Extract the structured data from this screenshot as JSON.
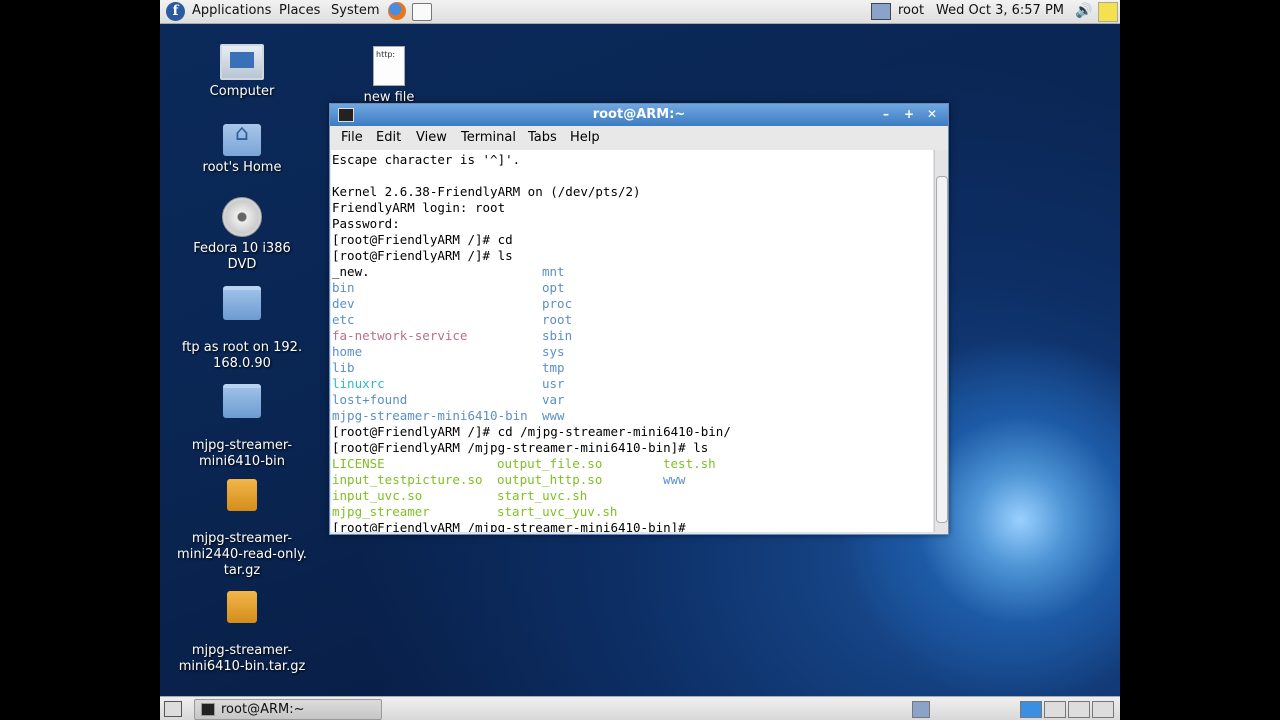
{
  "top_panel": {
    "menus": [
      "Applications",
      "Places",
      "System"
    ],
    "user": "root",
    "clock": "Wed Oct  3,  6:57 PM"
  },
  "desktop_icons": [
    {
      "label": "Computer",
      "icon": "computer-icon"
    },
    {
      "label": "root's Home",
      "icon": "home-folder-icon"
    },
    {
      "label": "Fedora 10 i386 DVD",
      "icon": "dvd-icon"
    },
    {
      "label": "ftp as root on 192.\n168.0.90",
      "icon": "network-folder-icon"
    },
    {
      "label": "mjpg-streamer-\nmini6410-bin",
      "icon": "folder-icon"
    },
    {
      "label": "mjpg-streamer-\nmini2440-read-only.\ntar.gz",
      "icon": "archive-icon"
    },
    {
      "label": "mjpg-streamer-\nmini6410-bin.tar.gz",
      "icon": "archive-icon"
    },
    {
      "label": "new file",
      "icon": "file-icon"
    }
  ],
  "new_file_icon_text": "http:",
  "terminal": {
    "title": "root@ARM:~",
    "menu": [
      "File",
      "Edit",
      "View",
      "Terminal",
      "Tabs",
      "Help"
    ],
    "lines": [
      "Escape character is '^]'.",
      "",
      "Kernel 2.6.38-FriendlyARM on (/dev/pts/2)",
      "FriendlyARM login: root",
      "Password:",
      "[root@FriendlyARM /]# cd",
      "[root@FriendlyARM /]# ls"
    ],
    "ls_root_left": [
      "_new.",
      "bin",
      "dev",
      "etc",
      "fa-network-service",
      "home",
      "lib",
      "linuxrc",
      "lost+found",
      "mjpg-streamer-mini6410-bin"
    ],
    "ls_root_right": [
      "mnt",
      "opt",
      "proc",
      "root",
      "sbin",
      "sys",
      "tmp",
      "usr",
      "var",
      "www"
    ],
    "line_cd": "[root@FriendlyARM /]# cd /mjpg-streamer-mini6410-bin/",
    "line_ls": "[root@FriendlyARM /mjpg-streamer-mini6410-bin]# ls",
    "ls_dir_col1": [
      "LICENSE",
      "input_testpicture.so",
      "input_uvc.so",
      "mjpg_streamer"
    ],
    "ls_dir_col2": [
      "output_file.so",
      "output_http.so",
      "start_uvc.sh",
      "start_uvc_yuv.sh"
    ],
    "ls_dir_col3": [
      "test.sh",
      "www"
    ],
    "prompt": "[root@FriendlyARM /mjpg-streamer-mini6410-bin]#"
  },
  "taskbar": {
    "task": "root@ARM:~"
  },
  "colors": {
    "dir": "#5c8fc7",
    "exec": "#7fbf24",
    "link": "#2fb7c9",
    "special": "#b5708f"
  }
}
